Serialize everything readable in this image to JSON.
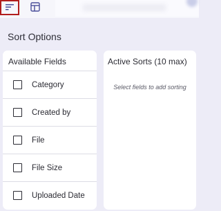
{
  "header": {
    "tabs": [
      {
        "icon": "sort-lines-icon",
        "active": true
      },
      {
        "icon": "table-icon",
        "active": false
      }
    ]
  },
  "title": "Sort Options",
  "available": {
    "title": "Available Fields",
    "fields": [
      "Category",
      "Created by",
      "File",
      "File Size",
      "Uploaded Date"
    ]
  },
  "active": {
    "title": "Active Sorts (10 max)",
    "empty_hint": "Select fields to add sorting"
  },
  "colors": {
    "background": "#edecf7",
    "panel": "#ffffff",
    "selected_outline": "#b11d1d"
  }
}
